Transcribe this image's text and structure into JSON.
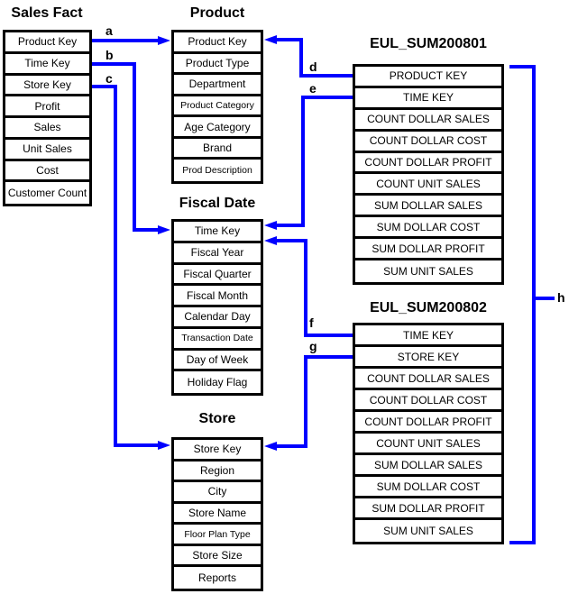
{
  "tables": {
    "sales_fact": {
      "title": "Sales Fact",
      "rows": [
        "Product Key",
        "Time Key",
        "Store Key",
        "Profit",
        "Sales",
        "Unit Sales",
        "Cost",
        "Customer Count"
      ]
    },
    "product": {
      "title": "Product",
      "rows": [
        "Product Key",
        "Product Type",
        "Department",
        "Product Category",
        "Age Category",
        "Brand",
        "Prod Description"
      ]
    },
    "fiscal_date": {
      "title": "Fiscal Date",
      "rows": [
        "Time Key",
        "Fiscal Year",
        "Fiscal Quarter",
        "Fiscal Month",
        "Calendar Day",
        "Transaction Date",
        "Day of Week",
        "Holiday Flag"
      ]
    },
    "store": {
      "title": "Store",
      "rows": [
        "Store Key",
        "Region",
        "City",
        "Store Name",
        "Floor Plan Type",
        "Store Size",
        "Reports"
      ]
    },
    "eul_sum200801": {
      "title": "EUL_SUM200801",
      "rows": [
        "PRODUCT KEY",
        "TIME KEY",
        "COUNT DOLLAR SALES",
        "COUNT DOLLAR COST",
        "COUNT DOLLAR PROFIT",
        "COUNT UNIT SALES",
        "SUM DOLLAR SALES",
        "SUM DOLLAR COST",
        "SUM DOLLAR PROFIT",
        "SUM UNIT SALES"
      ]
    },
    "eul_sum200802": {
      "title": "EUL_SUM200802",
      "rows": [
        "TIME KEY",
        "STORE KEY",
        "COUNT DOLLAR SALES",
        "COUNT DOLLAR COST",
        "COUNT DOLLAR PROFIT",
        "COUNT UNIT SALES",
        "SUM DOLLAR SALES",
        "SUM DOLLAR COST",
        "SUM DOLLAR PROFIT",
        "SUM UNIT SALES"
      ]
    }
  },
  "connectors": [
    {
      "label": "a",
      "from": "Sales Fact.Product Key",
      "to": "Product.Product Key"
    },
    {
      "label": "b",
      "from": "Sales Fact.Time Key",
      "to": "Fiscal Date.Time Key"
    },
    {
      "label": "c",
      "from": "Sales Fact.Store Key",
      "to": "Store.Store Key"
    },
    {
      "label": "d",
      "from": "EUL_SUM200801.PRODUCT KEY",
      "to": "Product.Product Key"
    },
    {
      "label": "e",
      "from": "EUL_SUM200801.TIME KEY",
      "to": "Fiscal Date.Time Key"
    },
    {
      "label": "f",
      "from": "EUL_SUM200802.TIME KEY",
      "to": "Fiscal Date.Time Key"
    },
    {
      "label": "g",
      "from": "EUL_SUM200802.STORE KEY",
      "to": "Store.Store Key"
    },
    {
      "label": "h",
      "from": "EUL_SUM200801",
      "to": "EUL_SUM200802",
      "kind": "bracket"
    }
  ],
  "colors": {
    "connector": "#0000ff",
    "border": "#000000",
    "text": "#000000",
    "background": "#ffffff"
  }
}
